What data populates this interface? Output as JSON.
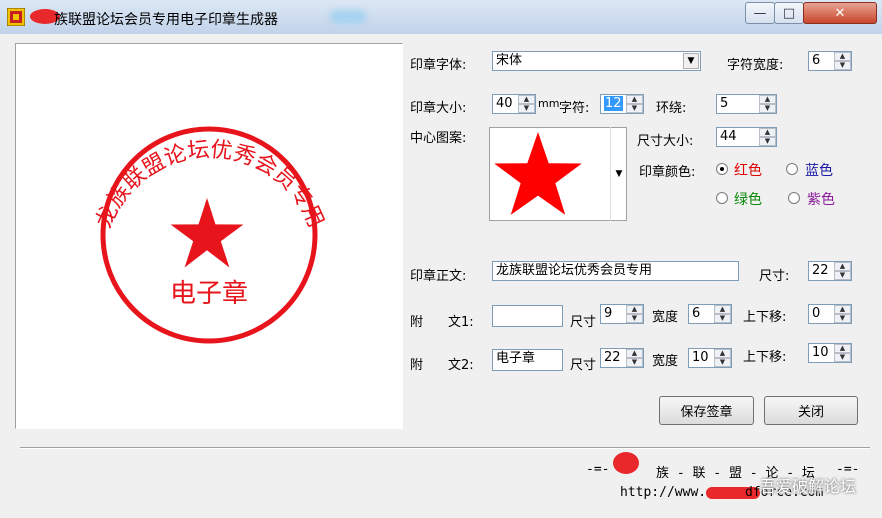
{
  "window": {
    "title": "龙族联盟论坛会员专用电子印章生成器",
    "title_visible": "族联盟论坛会员专用电子印章生成器",
    "controls": {
      "minimize": "—",
      "maximize": "□",
      "close": "✕"
    }
  },
  "stamp_preview": {
    "ring_text": "龙族联盟论坛优秀会员专用",
    "sub_text": "电子章",
    "color": "#e8141c"
  },
  "form": {
    "font_label": "印章字体:",
    "font_value": "宋体",
    "char_width_label": "字符宽度:",
    "char_width_value": "6",
    "size_label": "印章大小:",
    "size_value": "40",
    "size_unit": "mm",
    "char_label": "字符:",
    "char_value": "12",
    "ring_label": "环绕:",
    "ring_value": "5",
    "center_label": "中心图案:",
    "pattern_size_label": "尺寸大小:",
    "pattern_size_value": "44",
    "color_label": "印章颜色:",
    "colors": {
      "red": {
        "label": "红色",
        "color": "#e00000",
        "selected": true
      },
      "blue": {
        "label": "蓝色",
        "color": "#1a1aa6",
        "selected": false
      },
      "green": {
        "label": "绿色",
        "color": "#0a8a0a",
        "selected": false
      },
      "purple": {
        "label": "紫色",
        "color": "#8a1a9a",
        "selected": false
      }
    },
    "body_label": "印章正文:",
    "body_value": "龙族联盟论坛优秀会员专用",
    "body_size_label": "尺寸:",
    "body_size_value": "22",
    "sub1_label_a": "附",
    "sub1_label_b": "文1:",
    "sub1_value": "",
    "sub1_size_label": "尺寸",
    "sub1_size_value": "9",
    "sub1_width_label": "宽度",
    "sub1_width_value": "6",
    "sub1_shift_label": "上下移:",
    "sub1_shift_value": "0",
    "sub2_label_a": "附",
    "sub2_label_b": "文2:",
    "sub2_value": "电子章",
    "sub2_size_label": "尺寸",
    "sub2_size_value": "22",
    "sub2_width_label": "宽度",
    "sub2_width_value": "10",
    "sub2_shift_label": "上下移:",
    "sub2_shift_value": "10",
    "save_button": "保存签章",
    "close_button": "关闭"
  },
  "footer": {
    "left_dash": "-=-",
    "brand": "族 - 联 - 盟 - 论 - 坛",
    "right_dash": "-=-",
    "url_prefix": "http://www.",
    "url_suffix": "dforce.com",
    "watermark": "吾爱破解论坛"
  },
  "accent_colors": {
    "stamp_red": "#e8141c",
    "title_bar": "#c2d3ea"
  }
}
